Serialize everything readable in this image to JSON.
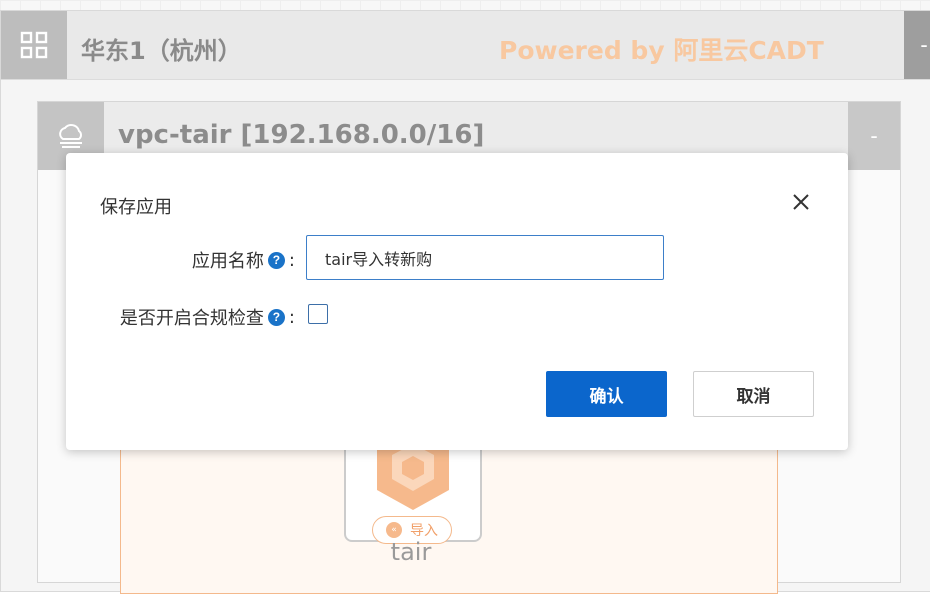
{
  "region": {
    "title": "华东1（杭州）",
    "powered_by": "Powered by 阿里云CADT",
    "collapse_label": "-",
    "icon": "grid-icon"
  },
  "vpc": {
    "title": "vpc-tair [192.168.0.0/16]",
    "collapse_label": "-",
    "icon": "cloud-icon"
  },
  "node": {
    "label": "tair",
    "import_label": "导入",
    "icon": "tair-hexagon-icon"
  },
  "modal": {
    "title": "保存应用",
    "close_icon": "close-icon",
    "fields": {
      "app_name": {
        "label": "应用名称",
        "help": "?",
        "colon": ":",
        "value": "tair导入转新购"
      },
      "compliance": {
        "label": "是否开启合规检查",
        "help": "?",
        "colon": ":",
        "checked": false
      }
    },
    "buttons": {
      "confirm": "确认",
      "cancel": "取消"
    }
  },
  "colors": {
    "primary": "#0b66cc",
    "powered_by": "#f8c8a0",
    "help_icon": "#1a73c8"
  }
}
